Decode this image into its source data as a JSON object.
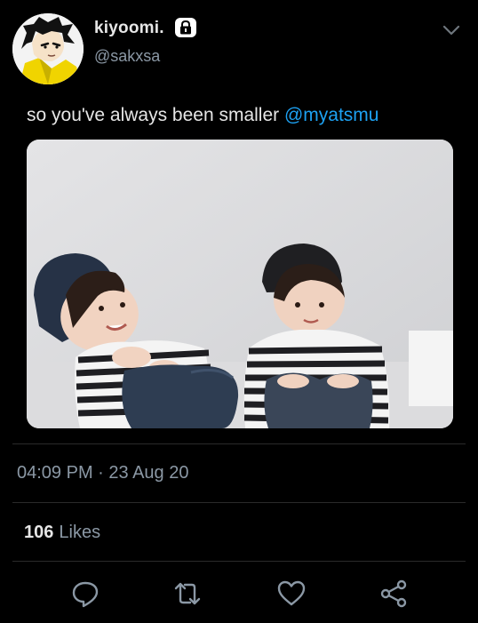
{
  "author": {
    "display_name": "kiyoomi.",
    "handle": "@sakxsa",
    "protected_icon": "lock-icon",
    "avatar_icon": "avatar-illustration"
  },
  "menu": {
    "icon": "chevron-down-icon"
  },
  "tweet": {
    "text": "so you've always been smaller ",
    "mention": "@myatsmu",
    "media": "photo of two children in beanies and striped shirts sitting against a white wall"
  },
  "meta": {
    "timestamp": "04:09 PM · 23 Aug 20"
  },
  "stats": {
    "likes_count": "106",
    "likes_label": "Likes"
  },
  "actions": [
    {
      "icon": "reply-icon"
    },
    {
      "icon": "retweet-icon"
    },
    {
      "icon": "heart-icon"
    },
    {
      "icon": "share-icon"
    }
  ],
  "colors": {
    "background": "#000000",
    "text": "#e6e6e6",
    "secondary_text": "#8b98a5",
    "link": "#1da1f2",
    "divider": "#2a2a2a"
  }
}
